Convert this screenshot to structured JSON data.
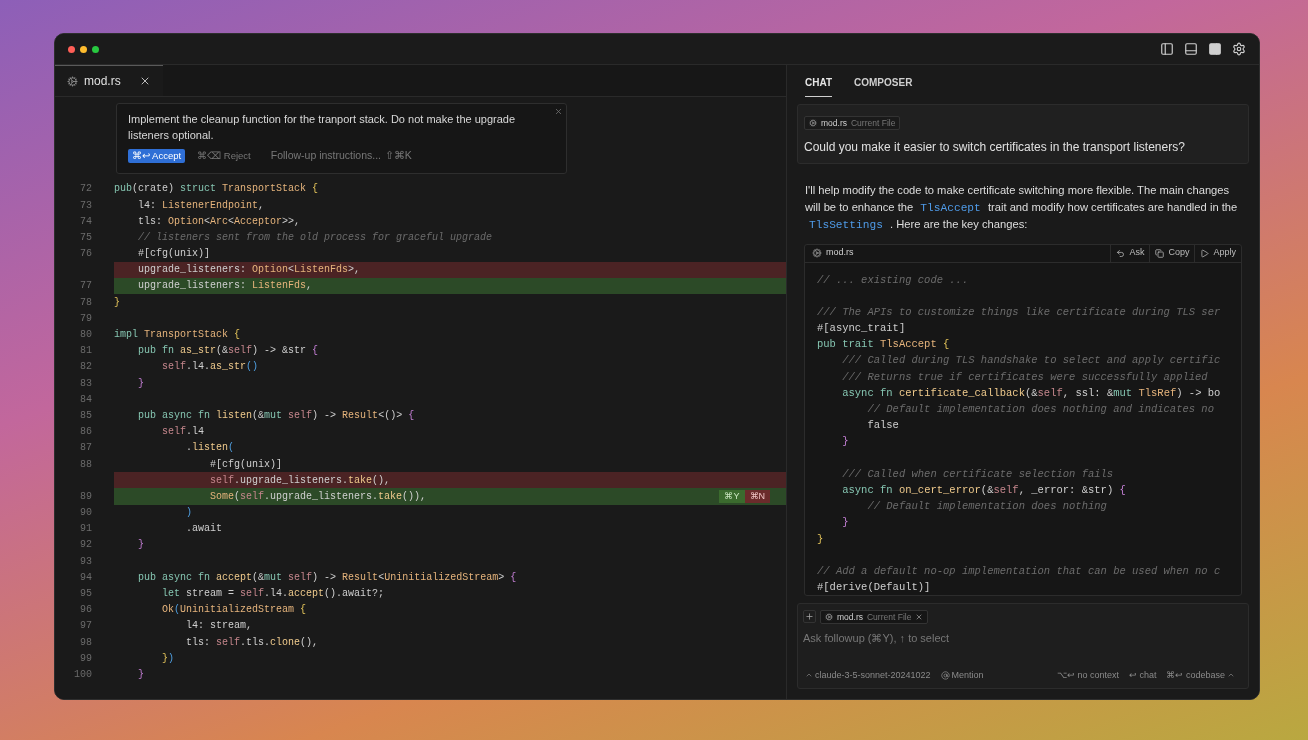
{
  "window": {
    "traffic_lights": [
      {
        "color": "#ff5f57"
      },
      {
        "color": "#febc2e"
      },
      {
        "color": "#28c840"
      }
    ]
  },
  "editor": {
    "tabs": [
      {
        "label": "mod.rs",
        "selected": true
      }
    ],
    "inline_prompt": {
      "text": "Implement the cleanup function for the tranport stack. Do not make the upgrade listeners optional.",
      "accept": "⌘↩ Accept",
      "reject": "⌘⌫ Reject",
      "followup_placeholder": "Follow-up instructions...",
      "followup_shortcut": "⇧⌘K"
    },
    "lines": [
      {
        "number": "72",
        "kind": "normal",
        "tokens": [
          {
            "text": "pub",
            "kind": "keyword"
          },
          {
            "text": "(crate) ",
            "kind": "plain"
          },
          {
            "text": "struct ",
            "kind": "keyword"
          },
          {
            "text": "TransportStack ",
            "kind": "type"
          },
          {
            "text": "{",
            "kind": "brace1"
          }
        ]
      },
      {
        "number": "73",
        "kind": "normal",
        "tokens": [
          {
            "text": "    l4: ",
            "kind": "plain"
          },
          {
            "text": "ListenerEndpoint",
            "kind": "type"
          },
          {
            "text": ",",
            "kind": "plain"
          }
        ]
      },
      {
        "number": "74",
        "kind": "normal",
        "tokens": [
          {
            "text": "    tls: ",
            "kind": "plain"
          },
          {
            "text": "Option",
            "kind": "type"
          },
          {
            "text": "<",
            "kind": "plain"
          },
          {
            "text": "Arc",
            "kind": "type"
          },
          {
            "text": "<",
            "kind": "plain"
          },
          {
            "text": "Acceptor",
            "kind": "type"
          },
          {
            "text": ">>,",
            "kind": "plain"
          }
        ]
      },
      {
        "number": "75",
        "kind": "normal",
        "tokens": [
          {
            "text": "    // listeners sent from the old process for graceful upgrade",
            "kind": "comment"
          }
        ]
      },
      {
        "number": "76",
        "kind": "normal",
        "tokens": [
          {
            "text": "    #[cfg(unix)]",
            "kind": "plain"
          }
        ]
      },
      {
        "kind": "removed",
        "tokens": [
          {
            "text": "    upgrade_listeners: ",
            "kind": "plain"
          },
          {
            "text": "Option",
            "kind": "type"
          },
          {
            "text": "<",
            "kind": "plain"
          },
          {
            "text": "ListenFds",
            "kind": "type"
          },
          {
            "text": ">,",
            "kind": "plain"
          }
        ]
      },
      {
        "number": "77",
        "kind": "added",
        "tokens": [
          {
            "text": "    upgrade_listeners: ",
            "kind": "plain"
          },
          {
            "text": "ListenFds",
            "kind": "type"
          },
          {
            "text": ",",
            "kind": "plain"
          }
        ]
      },
      {
        "number": "78",
        "kind": "normal",
        "tokens": [
          {
            "text": "}",
            "kind": "brace1"
          }
        ]
      },
      {
        "number": "79",
        "kind": "normal"
      },
      {
        "number": "80",
        "kind": "normal",
        "tokens": [
          {
            "text": "impl ",
            "kind": "keyword"
          },
          {
            "text": "TransportStack ",
            "kind": "type"
          },
          {
            "text": "{",
            "kind": "brace1"
          }
        ]
      },
      {
        "number": "81",
        "kind": "normal",
        "tokens": [
          {
            "text": "    pub fn ",
            "kind": "keyword"
          },
          {
            "text": "as_str",
            "kind": "function"
          },
          {
            "text": "(&",
            "kind": "plain"
          },
          {
            "text": "self",
            "kind": "self"
          },
          {
            "text": ") -> &str ",
            "kind": "plain"
          },
          {
            "text": "{",
            "kind": "brace2"
          }
        ]
      },
      {
        "number": "82",
        "kind": "normal",
        "tokens": [
          {
            "text": "        self",
            "kind": "self"
          },
          {
            "text": ".l4.",
            "kind": "plain"
          },
          {
            "text": "as_str",
            "kind": "function"
          },
          {
            "text": "()",
            "kind": "brace3"
          }
        ]
      },
      {
        "number": "83",
        "kind": "normal",
        "tokens": [
          {
            "text": "    }",
            "kind": "brace2"
          }
        ]
      },
      {
        "number": "84",
        "kind": "normal"
      },
      {
        "number": "85",
        "kind": "normal",
        "tokens": [
          {
            "text": "    pub async fn ",
            "kind": "keyword"
          },
          {
            "text": "listen",
            "kind": "function"
          },
          {
            "text": "(&",
            "kind": "plain"
          },
          {
            "text": "mut ",
            "kind": "keyword"
          },
          {
            "text": "self",
            "kind": "self"
          },
          {
            "text": ") -> ",
            "kind": "plain"
          },
          {
            "text": "Result",
            "kind": "type"
          },
          {
            "text": "<()> ",
            "kind": "plain"
          },
          {
            "text": "{",
            "kind": "brace2"
          }
        ]
      },
      {
        "number": "86",
        "kind": "normal",
        "tokens": [
          {
            "text": "        self",
            "kind": "self"
          },
          {
            "text": ".l4",
            "kind": "plain"
          }
        ]
      },
      {
        "number": "87",
        "kind": "normal",
        "tokens": [
          {
            "text": "            .",
            "kind": "plain"
          },
          {
            "text": "listen",
            "kind": "function"
          },
          {
            "text": "(",
            "kind": "brace3"
          }
        ]
      },
      {
        "number": "88",
        "kind": "normal",
        "tokens": [
          {
            "text": "                #[cfg(unix)]",
            "kind": "plain"
          }
        ]
      },
      {
        "kind": "removed",
        "tokens": [
          {
            "text": "                self",
            "kind": "self"
          },
          {
            "text": ".upgrade_listeners.",
            "kind": "plain"
          },
          {
            "text": "take",
            "kind": "function"
          },
          {
            "text": "(),",
            "kind": "plain"
          }
        ]
      },
      {
        "number": "89",
        "kind": "added",
        "tokens": [
          {
            "text": "                Some",
            "kind": "type"
          },
          {
            "text": "(",
            "kind": "plain"
          },
          {
            "text": "self",
            "kind": "self"
          },
          {
            "text": ".upgrade_listeners.",
            "kind": "plain"
          },
          {
            "text": "take",
            "kind": "function"
          },
          {
            "text": "()),",
            "kind": "plain"
          }
        ],
        "actions": [
          {
            "label": "⌘Y",
            "kind": "accept"
          },
          {
            "label": "⌘N",
            "kind": "reject"
          }
        ]
      },
      {
        "number": "90",
        "kind": "normal",
        "tokens": [
          {
            "text": "            )",
            "kind": "brace3"
          }
        ]
      },
      {
        "number": "91",
        "kind": "normal",
        "tokens": [
          {
            "text": "            .await",
            "kind": "plain"
          }
        ]
      },
      {
        "number": "92",
        "kind": "normal",
        "tokens": [
          {
            "text": "    }",
            "kind": "brace2"
          }
        ]
      },
      {
        "number": "93",
        "kind": "normal"
      },
      {
        "number": "94",
        "kind": "normal",
        "tokens": [
          {
            "text": "    pub async fn ",
            "kind": "keyword"
          },
          {
            "text": "accept",
            "kind": "function"
          },
          {
            "text": "(&",
            "kind": "plain"
          },
          {
            "text": "mut ",
            "kind": "keyword"
          },
          {
            "text": "self",
            "kind": "self"
          },
          {
            "text": ") -> ",
            "kind": "plain"
          },
          {
            "text": "Result",
            "kind": "type"
          },
          {
            "text": "<",
            "kind": "plain"
          },
          {
            "text": "UninitializedStream",
            "kind": "type"
          },
          {
            "text": "> ",
            "kind": "plain"
          },
          {
            "text": "{",
            "kind": "brace2"
          }
        ]
      },
      {
        "number": "95",
        "kind": "normal",
        "tokens": [
          {
            "text": "        let ",
            "kind": "keyword"
          },
          {
            "text": "stream = ",
            "kind": "plain"
          },
          {
            "text": "self",
            "kind": "self"
          },
          {
            "text": ".l4.",
            "kind": "plain"
          },
          {
            "text": "accept",
            "kind": "function"
          },
          {
            "text": "().await?;",
            "kind": "plain"
          }
        ]
      },
      {
        "number": "96",
        "kind": "normal",
        "tokens": [
          {
            "text": "        Ok",
            "kind": "type"
          },
          {
            "text": "(",
            "kind": "brace3"
          },
          {
            "text": "UninitializedStream ",
            "kind": "type"
          },
          {
            "text": "{",
            "kind": "brace1"
          }
        ]
      },
      {
        "number": "97",
        "kind": "normal",
        "tokens": [
          {
            "text": "            l4: stream,",
            "kind": "plain"
          }
        ]
      },
      {
        "number": "98",
        "kind": "normal",
        "tokens": [
          {
            "text": "            tls: ",
            "kind": "plain"
          },
          {
            "text": "self",
            "kind": "self"
          },
          {
            "text": ".tls.",
            "kind": "plain"
          },
          {
            "text": "clone",
            "kind": "function"
          },
          {
            "text": "(),",
            "kind": "plain"
          }
        ]
      },
      {
        "number": "99",
        "kind": "normal",
        "tokens": [
          {
            "text": "        }",
            "kind": "brace1"
          },
          {
            "text": ")",
            "kind": "brace3"
          }
        ]
      },
      {
        "number": "100",
        "kind": "normal",
        "tokens": [
          {
            "text": "    }",
            "kind": "brace2"
          }
        ]
      }
    ]
  },
  "chat": {
    "tabs": [
      {
        "label": "CHAT",
        "selected": true
      },
      {
        "label": "COMPOSER",
        "selected": false
      }
    ],
    "user_message": {
      "file_chip": {
        "name": "mod.rs",
        "tag": "Current File"
      },
      "text": "Could you make it easier to switch certificates in the transport listeners?"
    },
    "reply": [
      {
        "kind": "text",
        "text": "I'll help modify the code to make certificate switching more flexible. The main changes will be to enhance the "
      },
      {
        "kind": "code",
        "text": "TlsAccept"
      },
      {
        "kind": "text",
        "text": " trait and modify how certificates are handled in the "
      },
      {
        "kind": "code",
        "text": "TlsSettings"
      },
      {
        "kind": "text",
        "text": " . Here are the key changes:"
      }
    ],
    "code_block": {
      "file": "mod.rs",
      "actions": [
        {
          "label": "Ask",
          "kind": "ask"
        },
        {
          "label": "Copy",
          "kind": "copy"
        },
        {
          "label": "Apply",
          "kind": "apply"
        }
      ],
      "lines": [
        {
          "tokens": [
            {
              "text": "// ... existing code ...",
              "kind": "comment"
            }
          ]
        },
        {
          "blank_before": true,
          "tokens": [
            {
              "text": "/// The APIs to customize things like certificate during TLS ser",
              "kind": "comment"
            }
          ]
        },
        {
          "tokens": [
            {
              "text": "#[async_trait]",
              "kind": "plain"
            }
          ]
        },
        {
          "tokens": [
            {
              "text": "pub trait ",
              "kind": "keyword"
            },
            {
              "text": "TlsAccept ",
              "kind": "type"
            },
            {
              "text": "{",
              "kind": "brace1"
            }
          ]
        },
        {
          "tokens": [
            {
              "text": "    /// Called during TLS handshake to select and apply certific",
              "kind": "comment"
            }
          ]
        },
        {
          "tokens": [
            {
              "text": "    /// Returns true if certificates were successfully applied",
              "kind": "comment"
            }
          ]
        },
        {
          "tokens": [
            {
              "text": "    async fn ",
              "kind": "keyword"
            },
            {
              "text": "certificate_callback",
              "kind": "function"
            },
            {
              "text": "(&",
              "kind": "plain"
            },
            {
              "text": "self",
              "kind": "self"
            },
            {
              "text": ", ssl: &",
              "kind": "plain"
            },
            {
              "text": "mut ",
              "kind": "keyword"
            },
            {
              "text": "TlsRef",
              "kind": "type"
            },
            {
              "text": ") -> bo",
              "kind": "plain"
            }
          ]
        },
        {
          "tokens": [
            {
              "text": "        // Default implementation does nothing and indicates no",
              "kind": "comment"
            }
          ]
        },
        {
          "tokens": [
            {
              "text": "        false",
              "kind": "plain"
            }
          ]
        },
        {
          "tokens": [
            {
              "text": "    }",
              "kind": "brace2"
            }
          ]
        },
        {
          "blank_before": true,
          "tokens": [
            {
              "text": "    /// Called when certificate selection fails",
              "kind": "comment"
            }
          ]
        },
        {
          "tokens": [
            {
              "text": "    async fn ",
              "kind": "keyword"
            },
            {
              "text": "on_cert_error",
              "kind": "function"
            },
            {
              "text": "(&",
              "kind": "plain"
            },
            {
              "text": "self",
              "kind": "self"
            },
            {
              "text": ", _error: &str) ",
              "kind": "plain"
            },
            {
              "text": "{",
              "kind": "brace2"
            }
          ]
        },
        {
          "tokens": [
            {
              "text": "        // Default implementation does nothing",
              "kind": "comment"
            }
          ]
        },
        {
          "tokens": [
            {
              "text": "    }",
              "kind": "brace2"
            }
          ]
        },
        {
          "tokens": [
            {
              "text": "}",
              "kind": "brace1"
            }
          ]
        },
        {
          "blank_before": true,
          "tokens": [
            {
              "text": "// Add a default no-op implementation that can be used when no c",
              "kind": "comment"
            }
          ]
        },
        {
          "tokens": [
            {
              "text": "#[derive(Default)]",
              "kind": "plain"
            }
          ]
        }
      ]
    },
    "input": {
      "file_chip": {
        "name": "mod.rs",
        "tag": "Current File"
      },
      "placeholder": "Ask followup (⌘Y), ↑ to select",
      "model": "claude-3-5-sonnet-20241022",
      "mention": "Mention",
      "shortcuts": [
        "⌥↩ no context",
        "↩ chat",
        "⌘↩ codebase"
      ]
    }
  }
}
